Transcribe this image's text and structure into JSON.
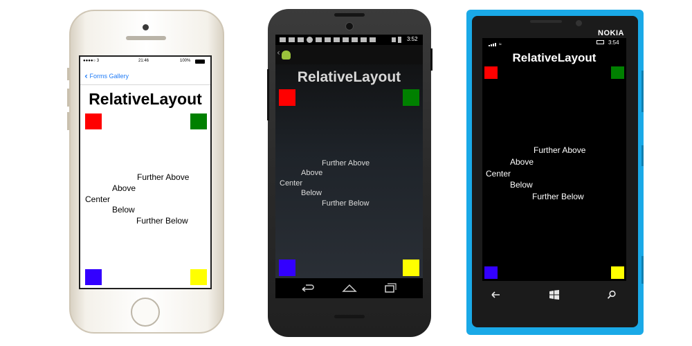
{
  "colors": {
    "red": "#ff0000",
    "green": "#008000",
    "blue": "#3300ff",
    "yellow": "#ffff00",
    "ios_link": "#1f7bf6",
    "nokia_body": "#1aa9e7"
  },
  "ios": {
    "status": {
      "carrier": "●●●●○ 3",
      "time": "21:46",
      "battery": "100%"
    },
    "back_label": "Forms Gallery",
    "title": "RelativeLayout",
    "labels": {
      "further_above": "Further Above",
      "above": "Above",
      "center": "Center",
      "below": "Below",
      "further_below": "Further Below"
    }
  },
  "android": {
    "status": {
      "time": "3:52"
    },
    "title": "RelativeLayout",
    "labels": {
      "further_above": "Further Above",
      "above": "Above",
      "center": "Center",
      "below": "Below",
      "further_below": "Further Below"
    },
    "nav_icons": [
      "back-icon",
      "home-icon",
      "recents-icon"
    ]
  },
  "windows_phone": {
    "brand": "NOKIA",
    "status": {
      "time": "3:54"
    },
    "title": "RelativeLayout",
    "labels": {
      "further_above": "Further Above",
      "above": "Above",
      "center": "Center",
      "below": "Below",
      "further_below": "Further Below"
    },
    "hardware_icons": [
      "back-icon",
      "windows-start-icon",
      "search-icon"
    ]
  }
}
